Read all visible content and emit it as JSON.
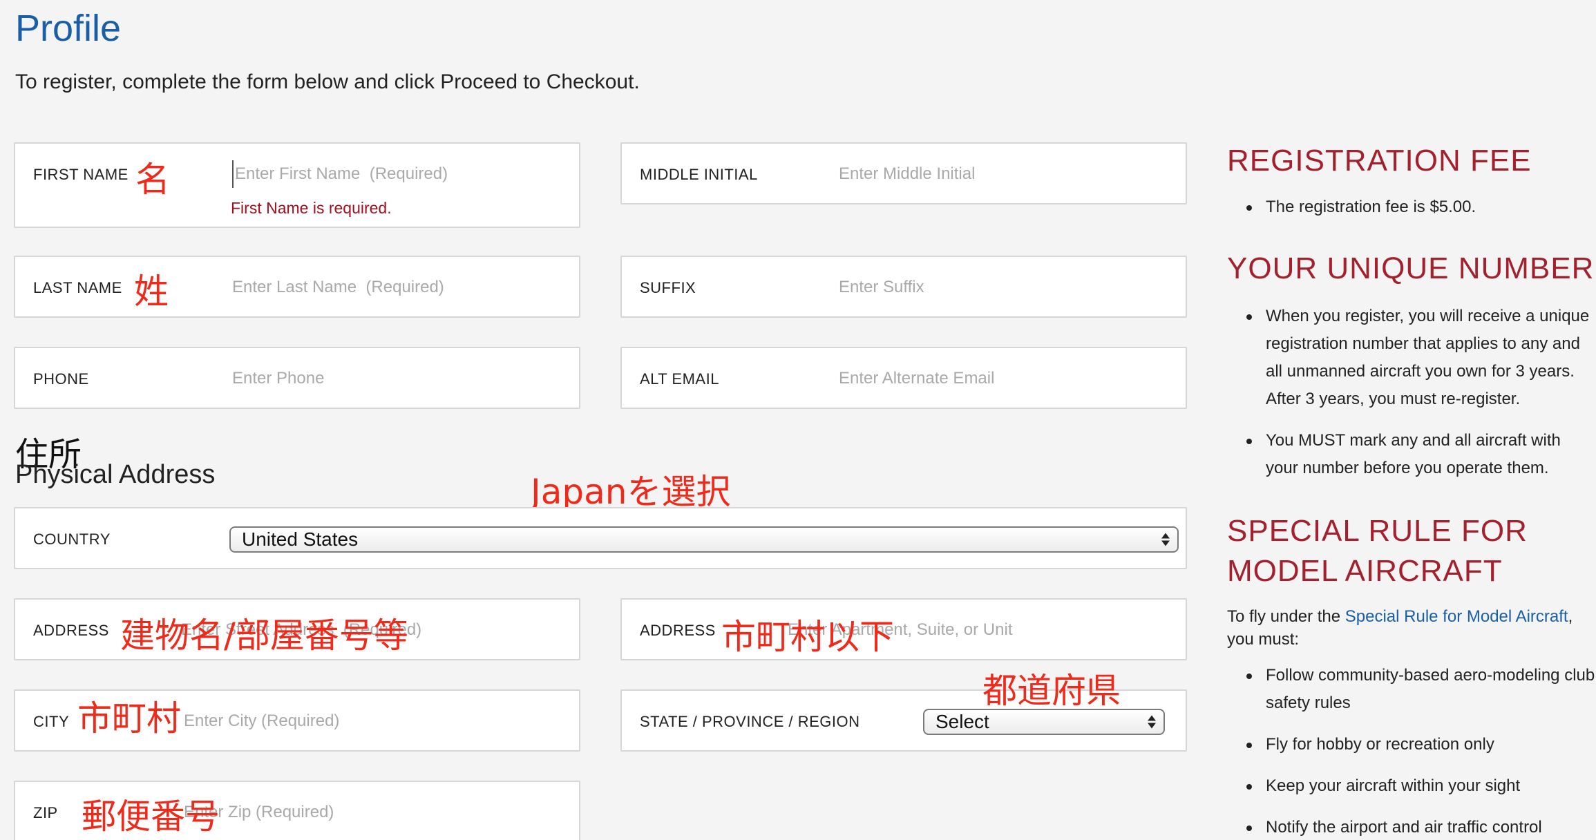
{
  "page": {
    "title": "Profile",
    "intro": "To register, complete the form below and click Proceed to Checkout."
  },
  "fields": {
    "first_name": {
      "label": "FIRST NAME",
      "placeholder": "Enter First Name  (Required)",
      "error": "First Name is required.",
      "annotation": "名"
    },
    "middle_initial": {
      "label": "MIDDLE INITIAL",
      "placeholder": "Enter Middle Initial"
    },
    "last_name": {
      "label": "LAST NAME",
      "placeholder": "Enter Last Name  (Required)",
      "annotation": "姓"
    },
    "suffix": {
      "label": "SUFFIX",
      "placeholder": "Enter Suffix"
    },
    "phone": {
      "label": "PHONE",
      "placeholder": "Enter Phone"
    },
    "alt_email": {
      "label": "ALT EMAIL",
      "placeholder": "Enter Alternate Email"
    }
  },
  "address_section": {
    "title_jp": "住所",
    "title": "Physical Address",
    "country_annotation": "Japanを選択",
    "country": {
      "label": "COUNTRY",
      "selected": "United States"
    },
    "address1": {
      "label": "ADDRESS",
      "placeholder": "Enter Street Address  (Required)",
      "annotation": "建物名/部屋番号等"
    },
    "address2": {
      "label": "ADDRESS",
      "placeholder": "Enter Apartment, Suite, or Unit",
      "annotation": "市町村以下"
    },
    "city": {
      "label": "CITY",
      "placeholder": "Enter City (Required)",
      "annotation": "市町村"
    },
    "state": {
      "label": "STATE / PROVINCE / REGION",
      "selected": "Select",
      "annotation": "都道府県"
    },
    "zip": {
      "label": "ZIP",
      "placeholder": "Enter Zip (Required)",
      "annotation": "郵便番号"
    }
  },
  "sidebar": {
    "fee_heading": "REGISTRATION FEE",
    "fee_items": [
      "The registration fee is $5.00."
    ],
    "unique_heading": "YOUR UNIQUE NUMBER",
    "unique_items": [
      "When you register, you will receive a unique registration number that applies to any and all unmanned aircraft you own for 3 years. After 3 years, you must re-register.",
      "You MUST mark any and all aircraft with your number before you operate them."
    ],
    "special_heading_line1": "SPECIAL RULE FOR",
    "special_heading_line2": "MODEL AIRCRAFT",
    "special_intro_prefix": "To fly under the ",
    "special_intro_link": "Special Rule for Model Aircraft",
    "special_intro_suffix": ", you must:",
    "special_items": [
      "Follow community-based aero-modeling club safety rules",
      "Fly for hobby or recreation only",
      "Keep your aircraft within your sight",
      "Notify the airport and air traffic control"
    ]
  },
  "colors": {
    "title_blue": "#1a5fa6",
    "sidebar_red": "#a3202d",
    "annotation_red": "#ef2a1b",
    "error_red": "#a0101e"
  }
}
